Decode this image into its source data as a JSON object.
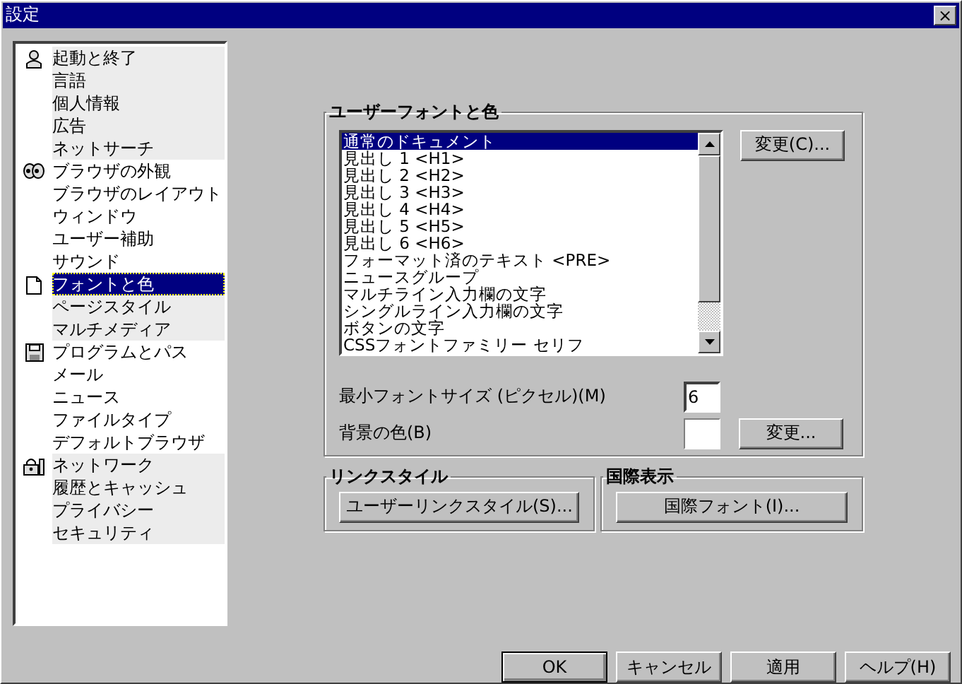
{
  "window": {
    "title": "設定",
    "close": "×"
  },
  "sidebar": {
    "groups": [
      {
        "items": [
          {
            "label": "起動と終了",
            "selected": false
          },
          {
            "label": "言語",
            "selected": false
          },
          {
            "label": "個人情報",
            "selected": false
          },
          {
            "label": "広告",
            "selected": false
          },
          {
            "label": "ネットサーチ",
            "selected": false
          }
        ]
      },
      {
        "items": [
          {
            "label": "ブラウザの外観",
            "selected": false
          },
          {
            "label": "ブラウザのレイアウト",
            "selected": false
          },
          {
            "label": "ウィンドウ",
            "selected": false
          },
          {
            "label": "ユーザー補助",
            "selected": false
          },
          {
            "label": "サウンド",
            "selected": false
          }
        ]
      },
      {
        "items": [
          {
            "label": "フォントと色",
            "selected": true
          },
          {
            "label": "ページスタイル",
            "selected": false
          },
          {
            "label": "マルチメディア",
            "selected": false
          }
        ]
      },
      {
        "items": [
          {
            "label": "プログラムとパス",
            "selected": false
          },
          {
            "label": "メール",
            "selected": false
          },
          {
            "label": "ニュース",
            "selected": false
          },
          {
            "label": "ファイルタイプ",
            "selected": false
          },
          {
            "label": "デフォルトブラウザ",
            "selected": false
          }
        ]
      },
      {
        "items": [
          {
            "label": "ネットワーク",
            "selected": false
          },
          {
            "label": "履歴とキャッシュ",
            "selected": false
          },
          {
            "label": "プライバシー",
            "selected": false
          },
          {
            "label": "セキュリティ",
            "selected": false
          }
        ]
      }
    ]
  },
  "user_fonts": {
    "title": "ユーザーフォントと色",
    "list": [
      {
        "label": "通常のドキュメント",
        "selected": true
      },
      {
        "label": "見出し 1 <H1>",
        "selected": false
      },
      {
        "label": "見出し 2 <H2>",
        "selected": false
      },
      {
        "label": "見出し 3 <H3>",
        "selected": false
      },
      {
        "label": "見出し 4 <H4>",
        "selected": false
      },
      {
        "label": "見出し 5 <H5>",
        "selected": false
      },
      {
        "label": "見出し 6 <H6>",
        "selected": false
      },
      {
        "label": "フォーマット済のテキスト <PRE>",
        "selected": false
      },
      {
        "label": "ニュースグループ",
        "selected": false
      },
      {
        "label": "マルチライン入力欄の文字",
        "selected": false
      },
      {
        "label": "シングルライン入力欄の文字",
        "selected": false
      },
      {
        "label": "ボタンの文字",
        "selected": false
      },
      {
        "label": "CSSフォントファミリー セリフ",
        "selected": false
      }
    ],
    "change_button": "変更(C)...",
    "min_size_label": "最小フォントサイズ (ピクセル)(M)",
    "min_size_value": "6",
    "bg_label": "背景の色(B)",
    "bg_button": "変更..."
  },
  "link_style": {
    "title": "リンクスタイル",
    "button": "ユーザーリンクスタイル(S)..."
  },
  "international": {
    "title": "国際表示",
    "button": "国際フォント(I)..."
  },
  "buttons": [
    "OK",
    "キャンセル",
    "適用",
    "ヘルプ(H)"
  ]
}
